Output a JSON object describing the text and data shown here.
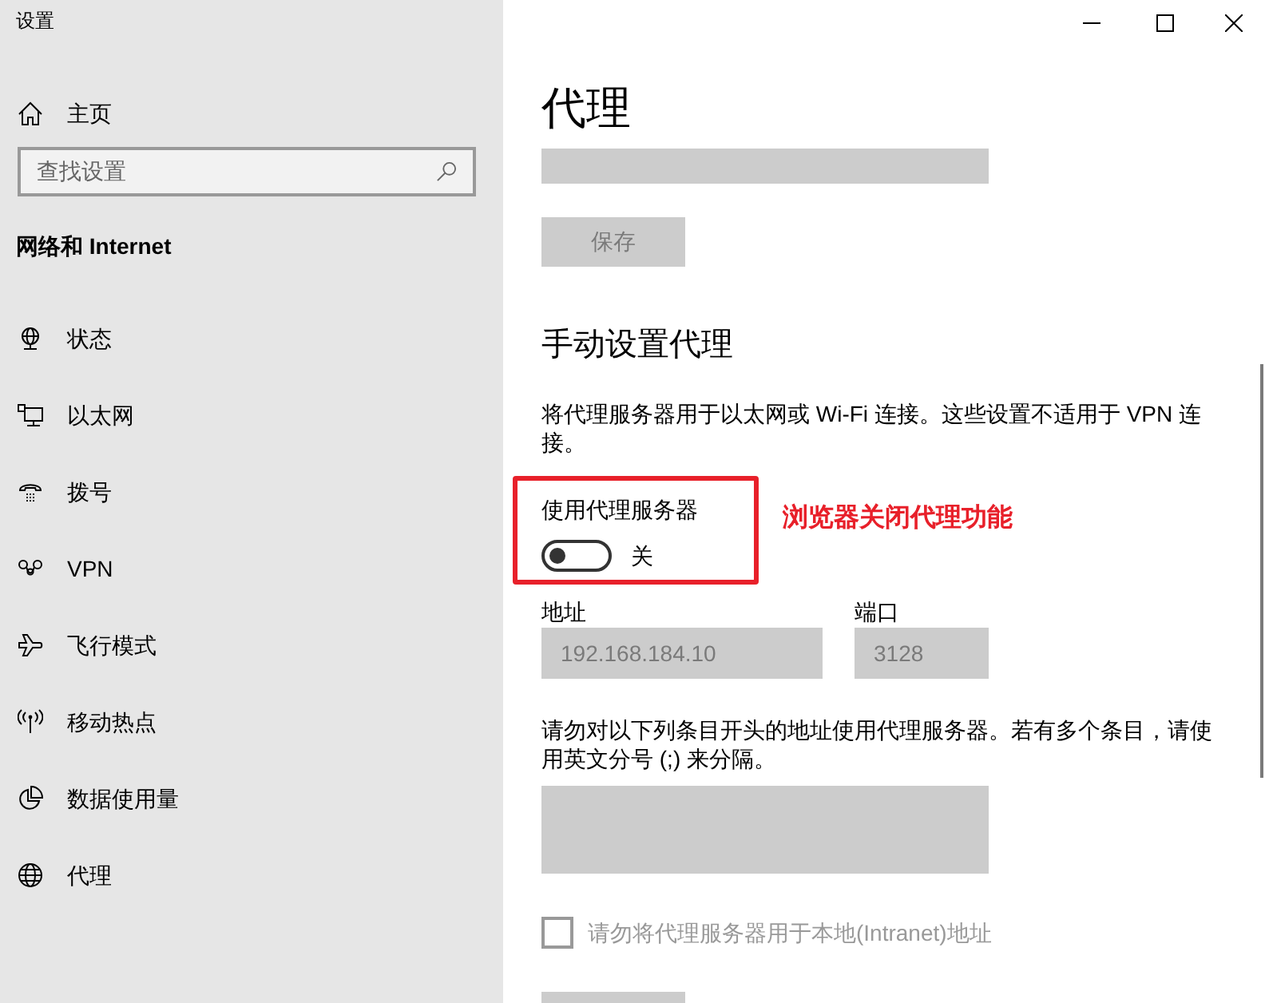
{
  "window": {
    "title": "设置"
  },
  "sidebar": {
    "home": {
      "label": "主页"
    },
    "search": {
      "placeholder": "查找设置"
    },
    "section_title": "网络和 Internet",
    "items": [
      {
        "label": "状态",
        "selected": false
      },
      {
        "label": "以太网",
        "selected": false
      },
      {
        "label": "拨号",
        "selected": false
      },
      {
        "label": "VPN",
        "selected": false
      },
      {
        "label": "飞行模式",
        "selected": false
      },
      {
        "label": "移动热点",
        "selected": false
      },
      {
        "label": "数据使用量",
        "selected": false
      },
      {
        "label": "代理",
        "selected": false
      }
    ]
  },
  "page": {
    "title": "代理",
    "script_address": {
      "disabled": true
    },
    "script_save": {
      "label": "保存",
      "disabled": true
    },
    "manual_heading": "手动设置代理",
    "manual_description": "将代理服务器用于以太网或 Wi-Fi 连接。这些设置不适用于 VPN 连接。",
    "use_proxy": {
      "label": "使用代理服务器",
      "on": false,
      "state_text": "关"
    },
    "annotation": {
      "text": "浏览器关闭代理功能"
    },
    "address": {
      "label": "地址",
      "value": "192.168.184.10",
      "disabled": true
    },
    "port": {
      "label": "端口",
      "value": "3128",
      "disabled": true
    },
    "exceptions_hint": "请勿对以下列条目开头的地址使用代理服务器。若有多个条目，请使用英文分号 (;) 来分隔。",
    "exceptions": {
      "disabled": true
    },
    "bypass_local": {
      "label": "请勿将代理服务器用于本地(Intranet)地址",
      "checked": false,
      "disabled": true
    },
    "manual_save": {
      "disabled": true
    }
  }
}
